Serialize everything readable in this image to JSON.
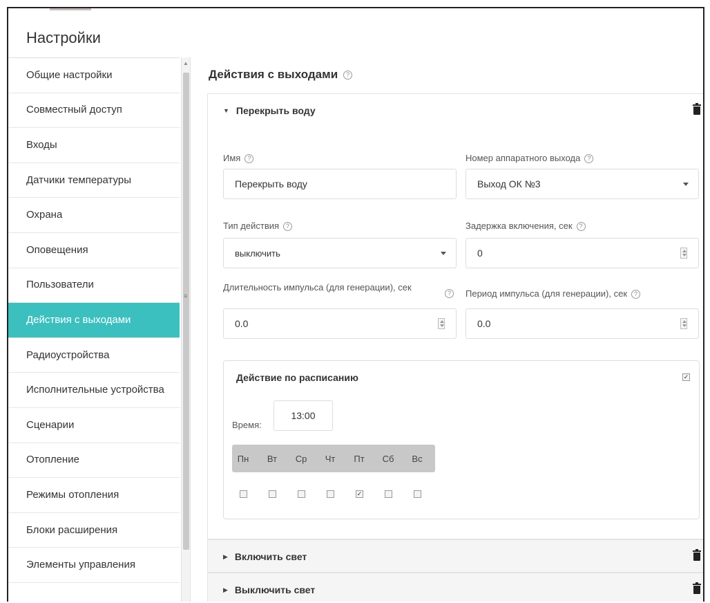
{
  "app": {
    "title": "Настройки"
  },
  "sidebar": {
    "items": [
      {
        "label": "Общие настройки"
      },
      {
        "label": "Совместный доступ"
      },
      {
        "label": "Входы"
      },
      {
        "label": "Датчики температуры"
      },
      {
        "label": "Охрана"
      },
      {
        "label": "Оповещения"
      },
      {
        "label": "Пользователи"
      },
      {
        "label": "Действия с выходами",
        "active": true
      },
      {
        "label": "Радиоустройства"
      },
      {
        "label": "Исполнительные устройства"
      },
      {
        "label": "Сценарии"
      },
      {
        "label": "Отопление"
      },
      {
        "label": "Режимы отопления"
      },
      {
        "label": "Блоки расширения"
      },
      {
        "label": "Элементы управления"
      }
    ]
  },
  "section": {
    "title": "Действия с выходами",
    "help": "?"
  },
  "actions": [
    {
      "title": "Перекрыть воду",
      "expanded": true,
      "fields": {
        "name_label": "Имя",
        "name_value": "Перекрыть воду",
        "output_label": "Номер аппаратного выхода",
        "output_value": "Выход ОК №3",
        "action_type_label": "Тип действия",
        "action_type_value": "выключить",
        "delay_label": "Задержка включения, сек",
        "delay_value": "0",
        "pulse_duration_label": "Длительность импульса (для генерации), сек",
        "pulse_duration_value": "0.0",
        "pulse_period_label": "Период импульса (для генерации), сек",
        "pulse_period_value": "0.0"
      },
      "schedule": {
        "title": "Действие по расписанию",
        "enabled": true,
        "time_label": "Время:",
        "time_value": "13:00",
        "days": [
          {
            "label": "Пн",
            "checked": false
          },
          {
            "label": "Вт",
            "checked": false
          },
          {
            "label": "Ср",
            "checked": false
          },
          {
            "label": "Чт",
            "checked": false
          },
          {
            "label": "Пт",
            "checked": true
          },
          {
            "label": "Сб",
            "checked": false
          },
          {
            "label": "Вс",
            "checked": false
          }
        ]
      }
    },
    {
      "title": "Включить свет",
      "expanded": false
    },
    {
      "title": "Выключить свет",
      "expanded": false
    }
  ],
  "icons": {
    "trash": "trash-icon",
    "help": "help-icon",
    "caret_down": "caret-down-icon",
    "caret_right": "caret-right-icon"
  },
  "colors": {
    "active_bg": "#3cbfbf",
    "active_text": "#ffffff"
  }
}
